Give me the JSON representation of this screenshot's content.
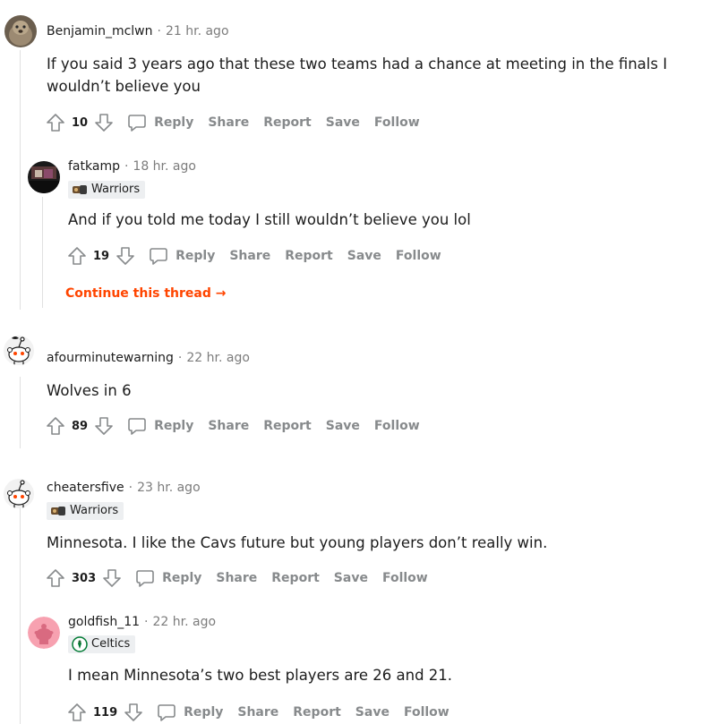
{
  "comments": [
    {
      "username": "Benjamin_mclwn",
      "time": "21 hr. ago",
      "body": "If you said 3 years ago that these two teams had a chance at meeting in the finals I wouldn’t believe you",
      "score": "10",
      "avatar_icon": "profile-photo-icon"
    },
    {
      "username": "fatkamp",
      "time": "18 hr. ago",
      "flair": "Warriors",
      "body": "And if you told me today I still wouldn’t believe you lol",
      "score": "19",
      "avatar_icon": "profile-photo-icon"
    },
    {
      "username": "afourminutewarning",
      "time": "22 hr. ago",
      "body": "Wolves in 6",
      "score": "89",
      "avatar_icon": "snoo-avatar-icon"
    },
    {
      "username": "cheatersfive",
      "time": "23 hr. ago",
      "flair": "Warriors",
      "body": "Minnesota. I like the Cavs future but young players don’t really win.",
      "score": "303",
      "avatar_icon": "snoo-avatar-icon"
    },
    {
      "username": "goldfish_11",
      "time": "22 hr. ago",
      "flair": "Celtics",
      "body": "I mean Minnesota’s two best players are 26 and 21.",
      "score": "119",
      "avatar_icon": "snoo-avatar-pink-icon"
    }
  ],
  "actions": {
    "reply": "Reply",
    "share": "Share",
    "report": "Report",
    "save": "Save",
    "follow": "Follow"
  },
  "continue_thread": "Continue this thread",
  "colors": {
    "accent": "#ff4500",
    "muted": "#878a8c",
    "text": "#1c1c1c",
    "flair_bg": "#edeff1"
  }
}
